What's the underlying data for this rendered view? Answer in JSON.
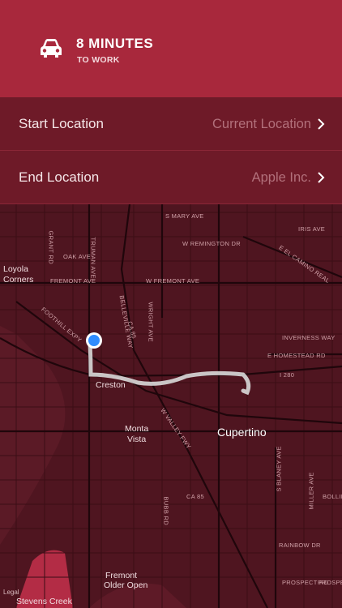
{
  "header": {
    "title": "8 MINUTES",
    "subtitle": "TO WORK",
    "icon": "car-icon"
  },
  "rows": [
    {
      "label": "Start Location",
      "value": "Current Location"
    },
    {
      "label": "End Location",
      "value": "Apple Inc."
    }
  ],
  "map": {
    "streets": [
      "S MARY AVE",
      "W REMINGTON DR",
      "IRIS AVE",
      "E EL CAMINO REAL",
      "GRANT RD",
      "TRUMAN AVE",
      "OAK AVE",
      "W FREMONT AVE",
      "FREMONT AVE",
      "BELLEVILLE WAY",
      "WRIGHT AVE",
      "CA 85",
      "FOOTHILL EXPY",
      "INVERNESS WAY",
      "E HOMESTEAD RD",
      "I 280",
      "W VALLEY FWY",
      "BUBB RD",
      "CA 85",
      "S BLANEY AVE",
      "MILLER AVE",
      "BOLLIN",
      "RAINBOW DR",
      "PROSPECT RD",
      "PROSPE"
    ],
    "places": [
      "Loyola",
      "Corners",
      "Creston",
      "Monta",
      "Vista",
      "Fremont",
      "Older Open",
      "Stevens Creek",
      "Legal"
    ],
    "city": "Cupertino"
  },
  "colors": {
    "header": "#a8283c",
    "row": "#6e1a28",
    "map_bg": "#4f1520",
    "route": "#d9d9d9",
    "location_dot": "#2f8cff"
  }
}
